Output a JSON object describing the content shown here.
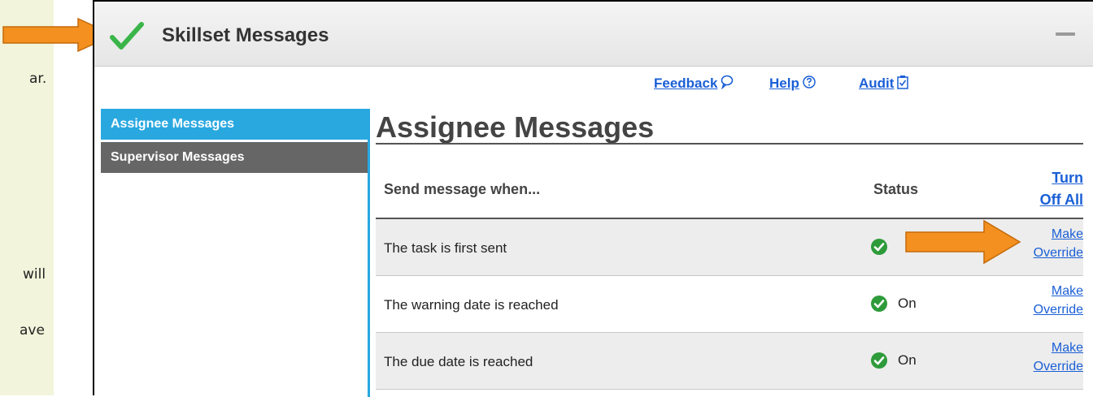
{
  "side_fragments": [
    "ar.",
    "will",
    "ave"
  ],
  "panel": {
    "title": "Skillset Messages",
    "links": {
      "feedback": "Feedback",
      "help": "Help",
      "audit": "Audit"
    }
  },
  "nav": {
    "items": [
      "Assignee Messages",
      "Supervisor Messages"
    ],
    "active_index": 0
  },
  "main": {
    "heading": "Assignee Messages",
    "table": {
      "headers": {
        "send_when": "Send message when...",
        "status": "Status",
        "turn_off_line1": "Turn",
        "turn_off_line2": "Off All"
      },
      "rows": [
        {
          "label": "The task is first sent",
          "status": "",
          "action_line1": "Make",
          "action_line2": "Override"
        },
        {
          "label": "The warning date is reached",
          "status": "On",
          "action_line1": "Make",
          "action_line2": "Override"
        },
        {
          "label": "The due date is reached",
          "status": "On",
          "action_line1": "Make",
          "action_line2": "Override"
        }
      ]
    }
  },
  "colors": {
    "accent": "#29a8e0",
    "nav_inactive": "#666666",
    "link": "#1a5fd6",
    "check": "#2e9b3a",
    "annotation_arrow": "#f3901f"
  }
}
